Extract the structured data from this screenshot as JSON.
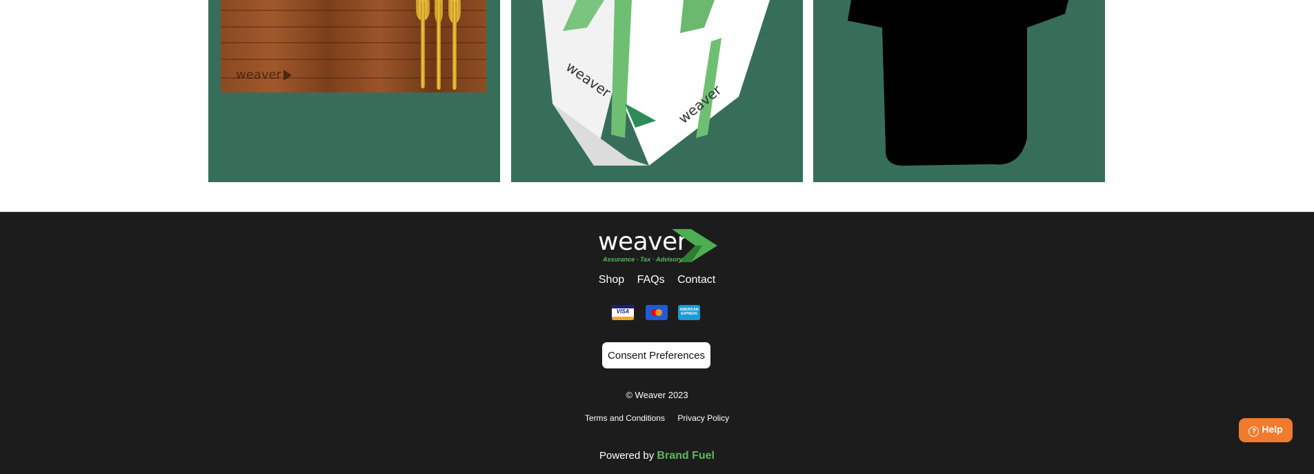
{
  "colors": {
    "card_background": "#376e5a",
    "footer_background": "#1c1c1c",
    "brand_green": "#5cb85c",
    "help_orange": "#f07a2e"
  },
  "products": {
    "board_engraving": "weaver"
  },
  "footer": {
    "logo": {
      "wordmark": "weaver",
      "tagline": "Assurance · Tax · Advisory"
    },
    "nav": [
      {
        "label": "Shop"
      },
      {
        "label": "FAQs"
      },
      {
        "label": "Contact"
      }
    ],
    "payment_methods": [
      {
        "name": "visa-icon",
        "text": "VISA"
      },
      {
        "name": "mastercard-icon"
      },
      {
        "name": "amex-icon",
        "text": "AMERICAN EXPRESS"
      }
    ],
    "consent_label": "Consent Preferences",
    "copyright": "© Weaver 2023",
    "legal": [
      {
        "label": "Terms and Conditions"
      },
      {
        "label": "Privacy Policy"
      }
    ],
    "powered_prefix": "Powered by",
    "powered_brand": "Brand Fuel"
  },
  "help": {
    "label": "Help",
    "icon": "question-circle-icon"
  }
}
